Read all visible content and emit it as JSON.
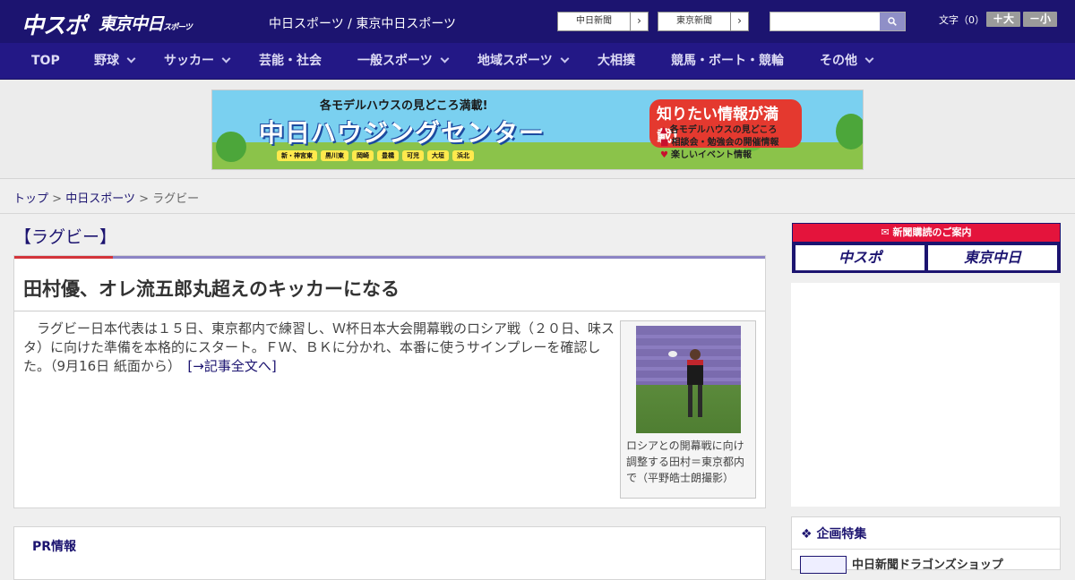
{
  "header": {
    "logo_main": "中スポ",
    "logo_sub": "東京中日",
    "logo_sub_small": "スポーツ",
    "site_name": "中日スポーツ / 東京中日スポーツ",
    "paper_links": [
      {
        "label": "中日新聞"
      },
      {
        "label": "東京新聞"
      }
    ],
    "search_placeholder": "",
    "font_size_label": "文字（0）",
    "font_larger": "＋大",
    "font_smaller": "－小"
  },
  "nav": [
    {
      "label": "TOP",
      "dropdown": false
    },
    {
      "label": "野球",
      "dropdown": true
    },
    {
      "label": "サッカー",
      "dropdown": true
    },
    {
      "label": "芸能・社会",
      "dropdown": false
    },
    {
      "label": "一般スポーツ",
      "dropdown": true
    },
    {
      "label": "地域スポーツ",
      "dropdown": true
    },
    {
      "label": "大相撲",
      "dropdown": false
    },
    {
      "label": "競馬・ボート・競輪",
      "dropdown": false
    },
    {
      "label": "その他",
      "dropdown": true
    }
  ],
  "banner": {
    "headline": "各モデルハウスの見どころ満載!",
    "title": "中日ハウジングセンター",
    "right_title": "知りたい情報が満載!",
    "features": [
      "各モデルハウスの見どころ",
      "相談会・勉強会の開催情報",
      "楽しいイベント情報"
    ],
    "cities": [
      "新・神宮東",
      "黒川東",
      "岡崎",
      "豊橋",
      "可児",
      "大垣",
      "浜北"
    ]
  },
  "breadcrumb": {
    "items": [
      "トップ",
      "中日スポーツ",
      "ラグビー"
    ],
    "separator": ">"
  },
  "article": {
    "category": "【ラグビー】",
    "headline": "田村優、オレ流五郎丸超えのキッカーになる",
    "body": "　ラグビー日本代表は１５日、東京都内で練習し、Ｗ杯日本大会開幕戦のロシア戦（２０日、味スタ）に向けた準備を本格的にスタート。ＦＷ、ＢＫに分かれ、本番に使うサインプレーを確認した。（9月16日 紙面から）",
    "more_link": "[→記事全文へ]",
    "photo_caption": "ロシアとの開幕戦に向け調整する田村＝東京都内で（平野皓士朗撮影）"
  },
  "pr": {
    "title": "PR情報"
  },
  "sidebar": {
    "subscribe_header": "新聞購読のご案内",
    "subscribe_buttons": [
      "中スポ",
      "東京中日"
    ],
    "feature_title": "企画特集",
    "feature_item": "中日新聞ドラゴンズショップ"
  },
  "colors": {
    "header_bg": "#1c1470",
    "nav_bg": "#231886",
    "accent_red": "#d3343a",
    "subscribe_red": "#e4143c"
  }
}
